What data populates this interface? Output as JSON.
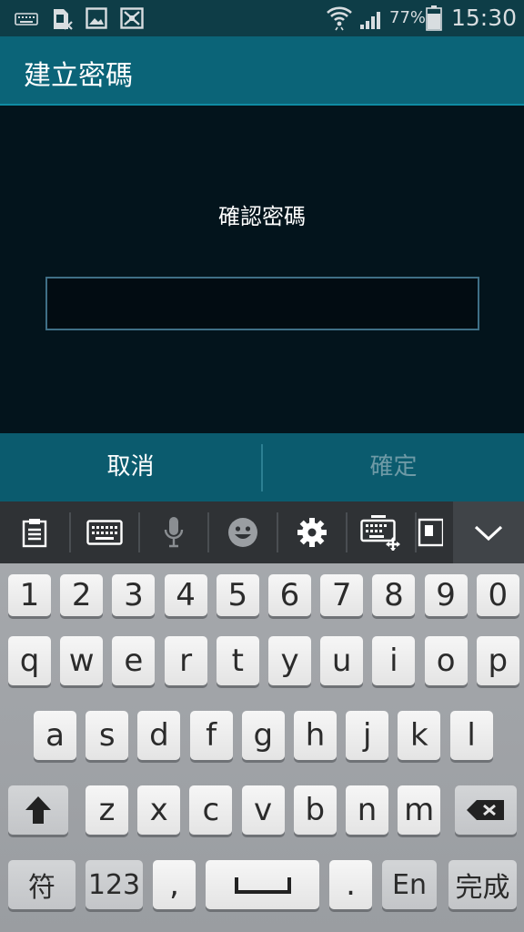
{
  "status_bar": {
    "battery": "77%",
    "time": "15:30",
    "icons": [
      "keyboard-icon",
      "sim-card-icon",
      "image-icon",
      "screenshot-icon",
      "wifi-icon",
      "signal-icon",
      "battery-icon"
    ]
  },
  "title": "建立密碼",
  "prompt": "確認密碼",
  "password_value": "",
  "actions": {
    "cancel": "取消",
    "confirm": "確定"
  },
  "toolbar": {
    "icons": [
      "clipboard-icon",
      "keyboard-icon",
      "microphone-icon",
      "emoji-icon",
      "settings-gear-icon",
      "keyboard-move-icon",
      "handwriting-icon",
      "chevron-down-icon"
    ]
  },
  "keyboard": {
    "row1": [
      "1",
      "2",
      "3",
      "4",
      "5",
      "6",
      "7",
      "8",
      "9",
      "0"
    ],
    "row2": [
      "q",
      "w",
      "e",
      "r",
      "t",
      "y",
      "u",
      "i",
      "o",
      "p"
    ],
    "row3": [
      "a",
      "s",
      "d",
      "f",
      "g",
      "h",
      "j",
      "k",
      "l"
    ],
    "row4": [
      "z",
      "x",
      "c",
      "v",
      "b",
      "n",
      "m"
    ],
    "symbols": "符",
    "numbers": "123",
    "comma": ",",
    "period": ".",
    "language": "En",
    "done": "完成"
  },
  "colors": {
    "status_bar": "#0e3d47",
    "title_bar": "#0b6478",
    "content_bg": "#03141c",
    "action_bar": "#0b5b6e",
    "disabled_text": "#6e9aa6"
  }
}
